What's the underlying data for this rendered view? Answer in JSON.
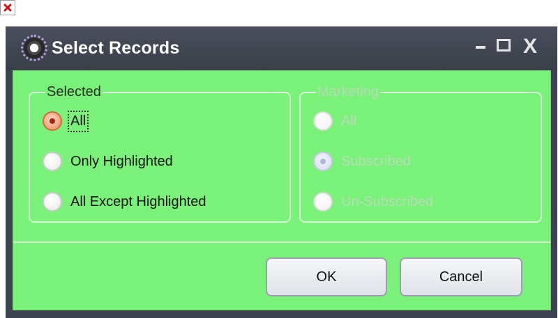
{
  "window": {
    "title": "Select Records",
    "controls": {
      "minimize": "_",
      "maximize": "□",
      "close": "X"
    },
    "icon": "app-icon"
  },
  "selected": {
    "legend": "Selected",
    "options": [
      {
        "label": "All",
        "checked": true,
        "focused": true
      },
      {
        "label": "Only Highlighted",
        "checked": false
      },
      {
        "label": "All Except Highlighted",
        "checked": false
      }
    ]
  },
  "marketing": {
    "legend": "Marketing",
    "disabled": true,
    "options": [
      {
        "label": "All",
        "checked": false
      },
      {
        "label": "Subscribed",
        "checked": true
      },
      {
        "label": "Un-Subscribed",
        "checked": false
      }
    ]
  },
  "buttons": {
    "ok": "OK",
    "cancel": "Cancel"
  },
  "colors": {
    "dialog_background": "#7af27a",
    "titlebar": "#3f4350",
    "radio_checked": "#f08a5b"
  },
  "icons": {
    "broken_image": "broken-image-icon"
  }
}
